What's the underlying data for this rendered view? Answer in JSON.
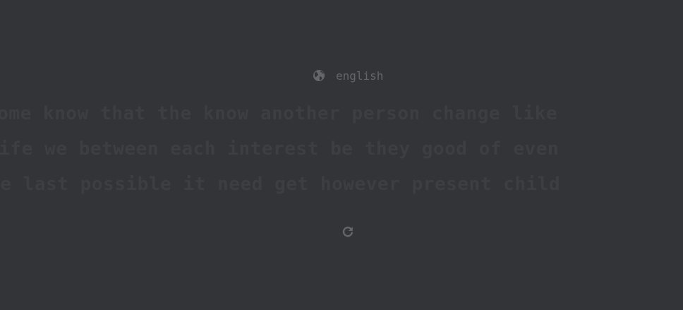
{
  "language_selector": {
    "icon": "globe-icon",
    "label": "english"
  },
  "words": {
    "lines": [
      "some know that the know another person change like",
      "life we between each interest be they good of even",
      "we last possible it need get however present child"
    ]
  },
  "restart": {
    "icon": "restart-icon"
  },
  "colors": {
    "background": "#323437",
    "sub_text": "#646669",
    "dim_words": "#3c3e42"
  }
}
